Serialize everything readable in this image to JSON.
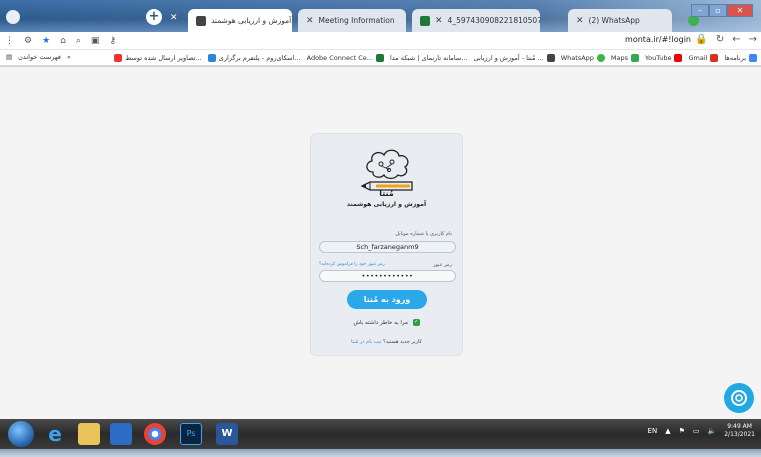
{
  "tabs": [
    {
      "title": "مُنتا - آموزش و ارزیابی هوشمند",
      "active": true
    },
    {
      "title": "Meeting Information",
      "active": false
    },
    {
      "title": "4_5974309082218105075.pdf",
      "active": false
    },
    {
      "title": "(2) WhatsApp",
      "active": false
    }
  ],
  "address": {
    "url": "monta.ir/#!login"
  },
  "bookmarks": {
    "apps": "برنامه‌ها",
    "items": [
      "Gmail",
      "YouTube",
      "Maps",
      "WhatsApp",
      "مُنتا - آموزش و ارزیابی ...",
      "سامانه تارنمای | شبکه مدا...",
      "Adobe Connect Ce...",
      "اسکای‌روم - پلتفرم برگزاری...",
      "تصاویر ارسال شده توسط..."
    ],
    "reading_list": "فهرست خواندن"
  },
  "login": {
    "brand": "مُنتا",
    "subtitle": "آموزش و ارزیابی هوشمند",
    "username_label": "نام کاربری یا شماره موبایل",
    "username_value": "Sch_farzaneganm9",
    "password_label": "رمز عبور",
    "forgot": "رمز عبور خود را فراموش کرده‌اید؟",
    "password_value": "••••••••••••",
    "submit": "ورود به مُنتا",
    "remember": "مرا به خاطر داشته باش",
    "register_prefix": "کاربر جدید هستید؟",
    "register_link": "ثبت نام در مُنتا"
  },
  "taskbar": {
    "lang": "EN",
    "time": "9:49 AM",
    "date": "2/13/2021"
  },
  "colors": {
    "accent": "#2aa8e9",
    "tabstrip": "#2d5a8c",
    "success": "#2e9e44"
  }
}
